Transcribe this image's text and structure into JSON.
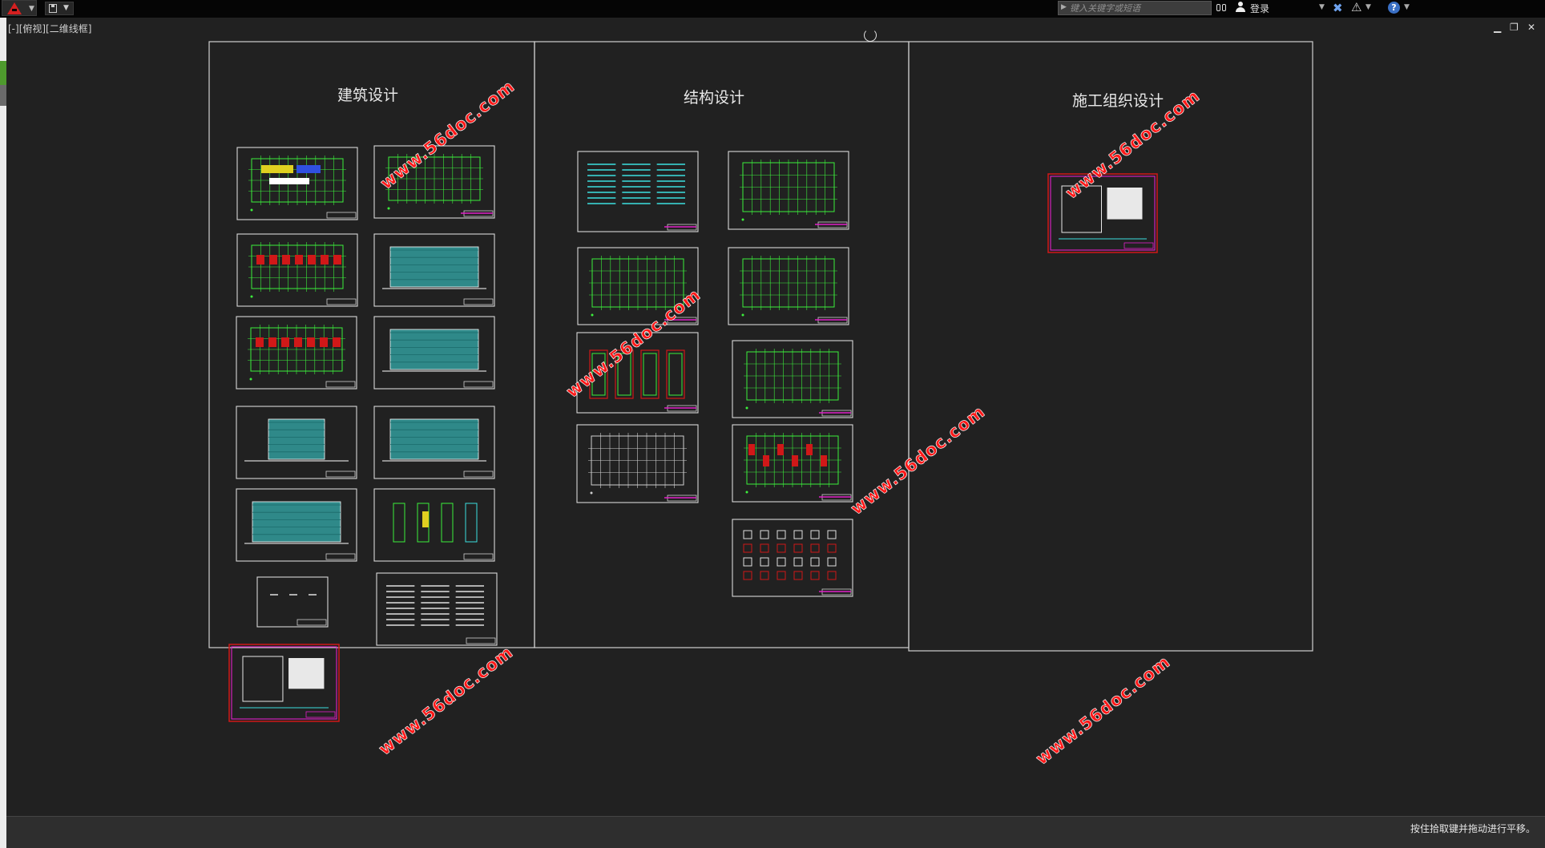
{
  "title_bar": {
    "search_placeholder": "键入关键字或短语",
    "login_label": "登录"
  },
  "viewport": {
    "label": "[-][俯视][二维线框]"
  },
  "drawing": {
    "section_titles": [
      "建筑设计",
      "结构设计",
      "施工组织设计"
    ],
    "watermark_text": "www.56doc.com"
  },
  "status_bar": {
    "message": "按住拾取键并拖动进行平移。"
  },
  "colors": {
    "background": "#212121",
    "frame_line": "#d0d0d0",
    "sheet_green": "#3cf03c",
    "sheet_cyan": "#3ce0e0",
    "sheet_magenta": "#e020c8",
    "sheet_red": "#d01818",
    "watermark": "#ff2020"
  }
}
